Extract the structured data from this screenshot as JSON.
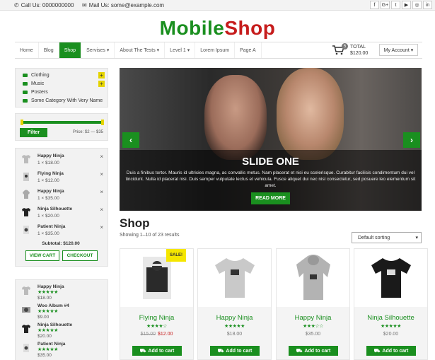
{
  "topbar": {
    "call": "Call Us: 0000000000",
    "mail": "Mail Us: some@example.com",
    "social_icons": [
      "facebook-icon",
      "googleplus-icon",
      "twitter-icon",
      "youtube-icon",
      "instagram-icon",
      "linkedin-icon"
    ],
    "social_glyphs": [
      "f",
      "G+",
      "t",
      "▶",
      "◎",
      "in"
    ]
  },
  "logo": {
    "part1": "Mobile",
    "part2": "Shop"
  },
  "nav": {
    "items": [
      "Home",
      "Blog",
      "Shop",
      "Servises ▾",
      "About The Tests ▾",
      "Level 1 ▾",
      "Lorem Ipsum",
      "Page A"
    ],
    "active_index": 2
  },
  "cart": {
    "total_label": "TOTAL",
    "total_value": "$120.00",
    "count": "5"
  },
  "account": {
    "label": "My Account ▾"
  },
  "sidebar": {
    "categories": [
      {
        "label": "Clothing",
        "expandable": true
      },
      {
        "label": "Music",
        "expandable": true
      },
      {
        "label": "Posters",
        "expandable": false
      },
      {
        "label": "Some Category With Very Name",
        "expandable": false
      }
    ],
    "filter": {
      "button": "Filter",
      "price": "Price: $2 — $35"
    },
    "cart_items": [
      {
        "name": "Happy Ninja",
        "qty": "1 × $18.00"
      },
      {
        "name": "Flying Ninja",
        "qty": "1 × $12.00"
      },
      {
        "name": "Happy Ninja",
        "qty": "1 × $35.00"
      },
      {
        "name": "Ninja Silhouette",
        "qty": "1 × $20.00"
      },
      {
        "name": "Patient Ninja",
        "qty": "1 × $35.00"
      }
    ],
    "subtotal": "Subtotal: $120.00",
    "view_cart": "VIEW CART",
    "checkout": "CHECKOUT",
    "top_rated": [
      {
        "name": "Happy Ninja",
        "stars": "★★★★★",
        "price": "$18.00"
      },
      {
        "name": "Woo Album #4",
        "stars": "★★★★★",
        "price": "$9.00"
      },
      {
        "name": "Ninja Silhouette",
        "stars": "★★★★★",
        "price": "$20.00"
      },
      {
        "name": "Patient Ninja",
        "stars": "★★★★★",
        "price": "$35.00"
      }
    ]
  },
  "slider": {
    "title": "SLIDE ONE",
    "text": "Duis a finibus tortor. Mauris id ultricies magna, ac convallis metus. Nam placerat et nisi eu scelerisque. Curabitur facilisis condimentum dui vel tincidunt. Nulla id placerat nisi. Duis semper vulputate lectus et vehicula. Fusce aliquet dui nec nisl consectetur, sed posuere leo elementum sit amet.",
    "button": "READ MORE",
    "prev": "‹",
    "next": "›"
  },
  "shop": {
    "title": "Shop",
    "results": "Showing 1–10 of 23 results",
    "sorting": "Default sorting"
  },
  "products": [
    {
      "name": "Flying Ninja",
      "stars": "★★★★☆",
      "old_price": "$15.00",
      "price": "$12.00",
      "sale": "SALE!",
      "add": "Add to cart"
    },
    {
      "name": "Happy Ninja",
      "stars": "★★★★★",
      "old_price": "",
      "price": "$18.00",
      "sale": "",
      "add": "Add to cart"
    },
    {
      "name": "Happy Ninja",
      "stars": "★★★☆☆",
      "old_price": "",
      "price": "$35.00",
      "sale": "",
      "add": "Add to cart"
    },
    {
      "name": "Ninja Silhouette",
      "stars": "★★★★★",
      "old_price": "",
      "price": "$20.00",
      "sale": "",
      "add": "Add to cart"
    }
  ],
  "colors": {
    "brand_green": "#1a8f1f",
    "brand_red": "#c61c1c",
    "accent_yellow": "#e5d400"
  }
}
